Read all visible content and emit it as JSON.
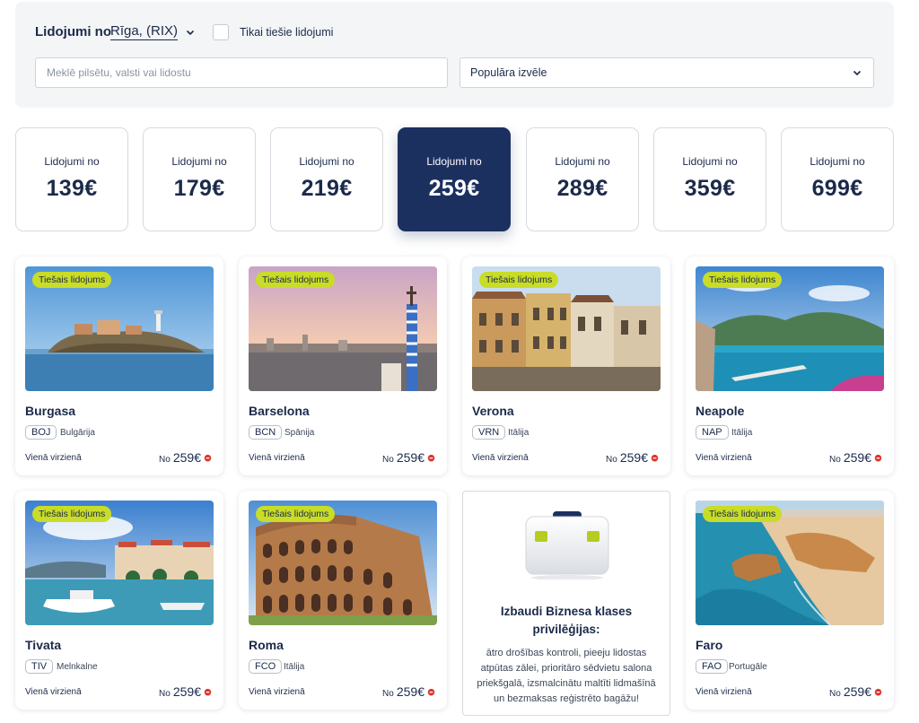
{
  "filters": {
    "from_label": "Lidojumi no",
    "origin": "Rīga, (RIX)",
    "direct_only_label": "Tikai tiešie lidojumi",
    "direct_only_checked": false,
    "search_placeholder": "Meklē pilsētu, valsti vai lidostu",
    "sort_value": "Populāra izvēle"
  },
  "price_filters": [
    {
      "label": "Lidojumi no",
      "price": "139€",
      "active": false
    },
    {
      "label": "Lidojumi no",
      "price": "179€",
      "active": false
    },
    {
      "label": "Lidojumi no",
      "price": "219€",
      "active": false
    },
    {
      "label": "Lidojumi no",
      "price": "259€",
      "active": true
    },
    {
      "label": "Lidojumi no",
      "price": "289€",
      "active": false
    },
    {
      "label": "Lidojumi no",
      "price": "359€",
      "active": false
    },
    {
      "label": "Lidojumi no",
      "price": "699€",
      "active": false
    }
  ],
  "destinations": [
    {
      "badge": "Tiešais lidojums",
      "city": "Burgasa",
      "iata": "BOJ",
      "country": "Bulgārija",
      "trip": "Vienā virzienā",
      "price_prefix": "No",
      "price": "259€"
    },
    {
      "badge": "Tiešais lidojums",
      "city": "Barselona",
      "iata": "BCN",
      "country": "Spānija",
      "trip": "Vienā virzienā",
      "price_prefix": "No",
      "price": "259€"
    },
    {
      "badge": "Tiešais lidojums",
      "city": "Verona",
      "iata": "VRN",
      "country": "Itālija",
      "trip": "Vienā virzienā",
      "price_prefix": "No",
      "price": "259€"
    },
    {
      "badge": "Tiešais lidojums",
      "city": "Neapole",
      "iata": "NAP",
      "country": "Itālija",
      "trip": "Vienā virzienā",
      "price_prefix": "No",
      "price": "259€"
    },
    {
      "badge": "Tiešais lidojums",
      "city": "Tivata",
      "iata": "TIV",
      "country": "Melnkalne",
      "trip": "Vienā virzienā",
      "price_prefix": "No",
      "price": "259€"
    },
    {
      "badge": "Tiešais lidojums",
      "city": "Roma",
      "iata": "FCO",
      "country": "Itālija",
      "trip": "Vienā virzienā",
      "price_prefix": "No",
      "price": "259€"
    },
    {
      "badge": "Tiešais lidojums",
      "city": "Faro",
      "iata": "FAO",
      "country": "Portugāle",
      "trip": "Vienā virzienā",
      "price_prefix": "No",
      "price": "259€"
    }
  ],
  "promo": {
    "title": "Izbaudi Biznesa klases privilēģijas:",
    "text": "ātro drošības kontroli, pieeju lidostas atpūtas zālei, prioritāro sēdvietu salona priekšgalā, izsmalcinātu maltīti lidmašīnā un bezmaksas reģistrēto bagāžu!",
    "icon": "briefcase-icon"
  },
  "colors": {
    "navy": "#1c3060",
    "badge_lime": "#c9dc27",
    "deal_icon_red": "#e0352b"
  }
}
